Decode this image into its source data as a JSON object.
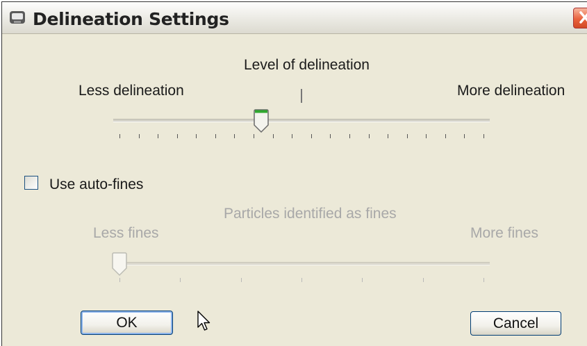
{
  "window": {
    "title": "Delineation Settings"
  },
  "delineation": {
    "heading": "Level of delineation",
    "left_label": "Less delineation",
    "right_label": "More delineation",
    "slider_value": 0.39,
    "tick_count": 20
  },
  "auto_fines": {
    "label": "Use auto-fines",
    "checked": false
  },
  "fines": {
    "heading": "Particles identified as fines",
    "left_label": "Less fines",
    "right_label": "More fines",
    "slider_value": 0.0,
    "tick_count": 7,
    "enabled": false
  },
  "buttons": {
    "ok_label": "OK",
    "cancel_label": "Cancel"
  }
}
